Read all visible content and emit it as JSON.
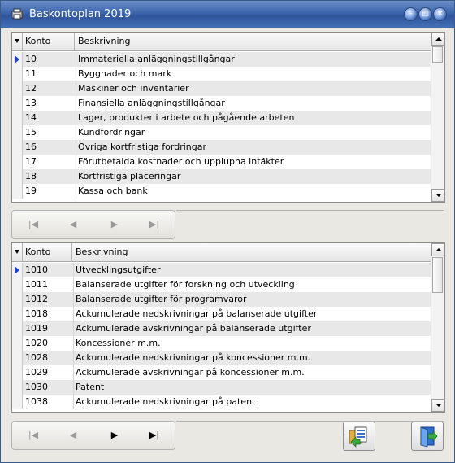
{
  "window": {
    "title": "Baskontoplan 2019"
  },
  "grid1": {
    "columns": [
      "Konto",
      "Beskrivning"
    ],
    "rows": [
      {
        "konto": "10",
        "beskrivning": "Immateriella anläggningstillgångar"
      },
      {
        "konto": "11",
        "beskrivning": "Byggnader och mark"
      },
      {
        "konto": "12",
        "beskrivning": "Maskiner och inventarier"
      },
      {
        "konto": "13",
        "beskrivning": " Finansiella anläggningstillgångar"
      },
      {
        "konto": "14",
        "beskrivning": "Lager, produkter i arbete och pågående arbeten"
      },
      {
        "konto": "15",
        "beskrivning": "Kundfordringar"
      },
      {
        "konto": "16",
        "beskrivning": "Övriga kortfristiga fordringar"
      },
      {
        "konto": "17",
        "beskrivning": "Förutbetalda kostnader och upplupna intäkter"
      },
      {
        "konto": "18",
        "beskrivning": "Kortfristiga placeringar"
      },
      {
        "konto": "19",
        "beskrivning": "Kassa och bank"
      }
    ]
  },
  "grid2": {
    "columns": [
      "Konto",
      "Beskrivning"
    ],
    "rows": [
      {
        "konto": "1010",
        "beskrivning": "Utvecklingsutgifter"
      },
      {
        "konto": "1011",
        "beskrivning": "Balanserade utgifter för forskning och utveckling"
      },
      {
        "konto": "1012",
        "beskrivning": "Balanserade utgifter för programvaror"
      },
      {
        "konto": "1018",
        "beskrivning": "Ackumulerade nedskrivningar på balanserade utgifter"
      },
      {
        "konto": "1019",
        "beskrivning": "Ackumulerade avskrivningar på balanserade utgifter"
      },
      {
        "konto": "1020",
        "beskrivning": "Koncessioner m.m."
      },
      {
        "konto": "1028",
        "beskrivning": "Ackumulerade nedskrivningar på koncessioner m.m."
      },
      {
        "konto": "1029",
        "beskrivning": "Ackumulerade avskrivningar på koncessioner m.m."
      },
      {
        "konto": "1030",
        "beskrivning": "Patent"
      },
      {
        "konto": "1038",
        "beskrivning": "Ackumulerade nedskrivningar på patent"
      }
    ]
  },
  "nav_icons": [
    "first-record-icon",
    "previous-record-icon",
    "next-record-icon",
    "last-record-icon"
  ],
  "colors": {
    "titlebar": "#3a63ab",
    "row_pointer": "#1e3fcf",
    "alt_row": "#e8e8e8"
  }
}
